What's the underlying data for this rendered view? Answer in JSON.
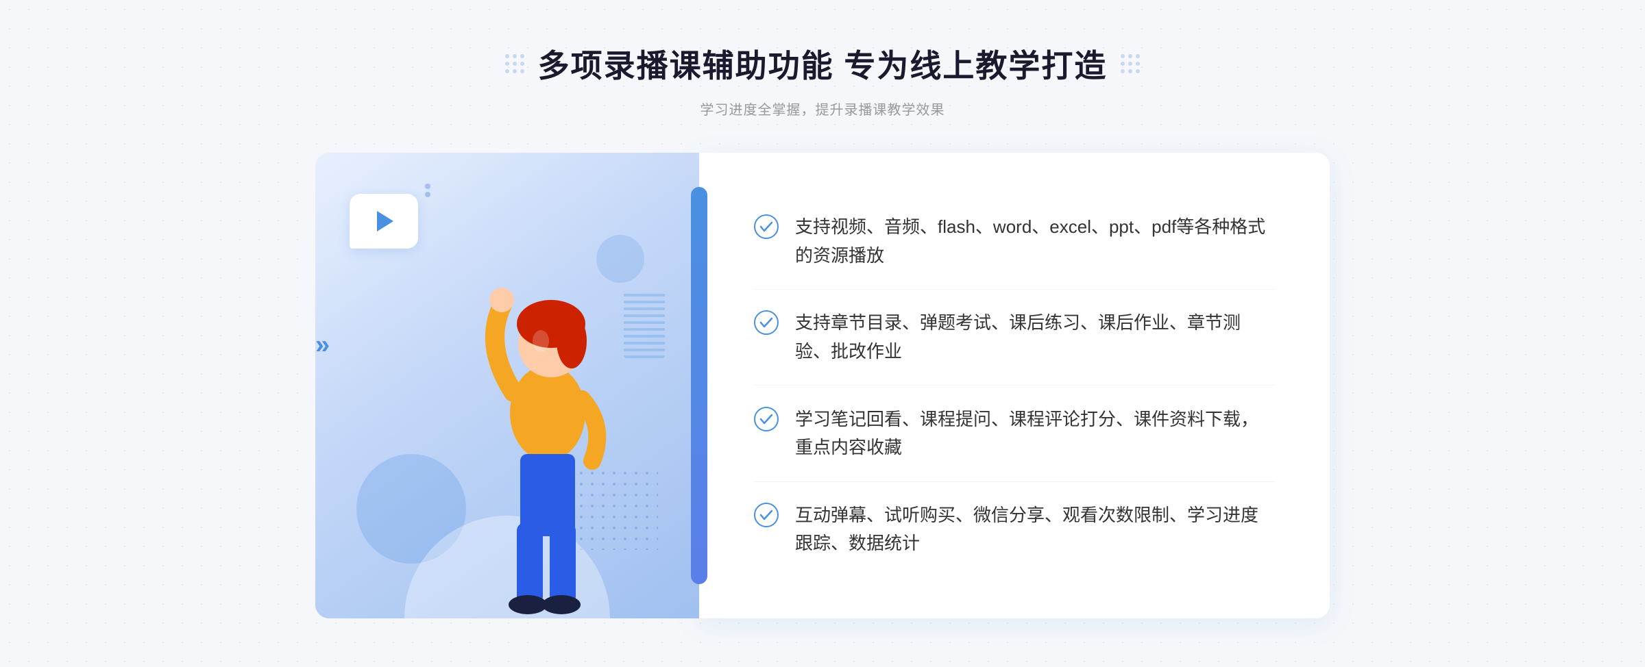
{
  "page": {
    "background_color": "#f5f7fa"
  },
  "header": {
    "title": "多项录播课辅助功能 专为线上教学打造",
    "subtitle": "学习进度全掌握，提升录播课教学效果",
    "decorative_dots_left": ":::::",
    "decorative_dots_right": ":::::"
  },
  "features": [
    {
      "id": 1,
      "text": "支持视频、音频、flash、word、excel、ppt、pdf等各种格式的资源播放"
    },
    {
      "id": 2,
      "text": "支持章节目录、弹题考试、课后练习、课后作业、章节测验、批改作业"
    },
    {
      "id": 3,
      "text": "学习笔记回看、课程提问、课程评论打分、课件资料下载，重点内容收藏"
    },
    {
      "id": 4,
      "text": "互动弹幕、试听购买、微信分享、观看次数限制、学习进度跟踪、数据统计"
    }
  ],
  "colors": {
    "primary_blue": "#4a90e2",
    "title_dark": "#1a1a2e",
    "subtitle_gray": "#999999",
    "text_color": "#333333",
    "check_color": "#4a90e2"
  },
  "left_arrow_symbol": "»",
  "play_icon": "▶"
}
